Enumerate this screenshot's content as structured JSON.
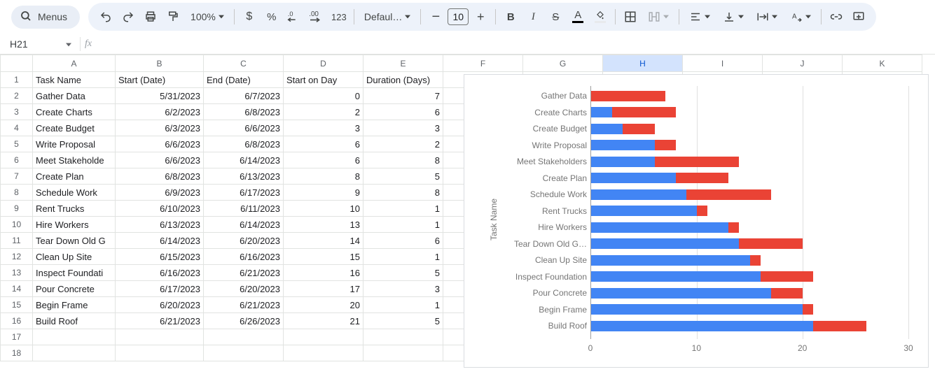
{
  "toolbar": {
    "menus_label": "Menus",
    "zoom": "100%",
    "font_name": "Defaul…",
    "font_size": "10"
  },
  "namebox": {
    "ref": "H21"
  },
  "columns": [
    "A",
    "B",
    "C",
    "D",
    "E",
    "F",
    "G",
    "H",
    "I",
    "J",
    "K"
  ],
  "selected_col": "H",
  "headers": {
    "A": "Task Name",
    "B": "Start (Date)",
    "C": "End (Date)",
    "D": "Start on Day",
    "E": "Duration (Days)"
  },
  "rows": [
    {
      "task": "Gather Data",
      "start": "5/31/2023",
      "end": "6/7/2023",
      "start_day": "0",
      "duration": "7"
    },
    {
      "task": "Create Charts",
      "start": "6/2/2023",
      "end": "6/8/2023",
      "start_day": "2",
      "duration": "6"
    },
    {
      "task": "Create Budget",
      "start": "6/3/2023",
      "end": "6/6/2023",
      "start_day": "3",
      "duration": "3"
    },
    {
      "task": "Write Proposal",
      "start": "6/6/2023",
      "end": "6/8/2023",
      "start_day": "6",
      "duration": "2"
    },
    {
      "task": "Meet Stakeholde",
      "start": "6/6/2023",
      "end": "6/14/2023",
      "start_day": "6",
      "duration": "8"
    },
    {
      "task": "Create Plan",
      "start": "6/8/2023",
      "end": "6/13/2023",
      "start_day": "8",
      "duration": "5"
    },
    {
      "task": "Schedule Work",
      "start": "6/9/2023",
      "end": "6/17/2023",
      "start_day": "9",
      "duration": "8"
    },
    {
      "task": "Rent Trucks",
      "start": "6/10/2023",
      "end": "6/11/2023",
      "start_day": "10",
      "duration": "1"
    },
    {
      "task": "Hire Workers",
      "start": "6/13/2023",
      "end": "6/14/2023",
      "start_day": "13",
      "duration": "1"
    },
    {
      "task": "Tear Down Old G",
      "start": "6/14/2023",
      "end": "6/20/2023",
      "start_day": "14",
      "duration": "6"
    },
    {
      "task": "Clean Up Site",
      "start": "6/15/2023",
      "end": "6/16/2023",
      "start_day": "15",
      "duration": "1"
    },
    {
      "task": "Inspect Foundati",
      "start": "6/16/2023",
      "end": "6/21/2023",
      "start_day": "16",
      "duration": "5"
    },
    {
      "task": "Pour Concrete",
      "start": "6/17/2023",
      "end": "6/20/2023",
      "start_day": "17",
      "duration": "3"
    },
    {
      "task": "Begin Frame",
      "start": "6/20/2023",
      "end": "6/21/2023",
      "start_day": "20",
      "duration": "1"
    },
    {
      "task": "Build Roof",
      "start": "6/21/2023",
      "end": "6/26/2023",
      "start_day": "21",
      "duration": "5"
    }
  ],
  "chart_data": {
    "type": "bar",
    "orientation": "horizontal",
    "stacked": true,
    "ylabel": "Task Name",
    "xlim": [
      0,
      30
    ],
    "xticks": [
      0,
      10,
      20,
      30
    ],
    "categories": [
      "Gather Data",
      "Create Charts",
      "Create Budget",
      "Write Proposal",
      "Meet Stakeholders",
      "Create Plan",
      "Schedule Work",
      "Rent Trucks",
      "Hire Workers",
      "Tear Down Old G…",
      "Clean Up Site",
      "Inspect Foundation",
      "Pour Concrete",
      "Begin Frame",
      "Build Roof"
    ],
    "series": [
      {
        "name": "Start on Day",
        "color": "#4285f4",
        "values": [
          0,
          2,
          3,
          6,
          6,
          8,
          9,
          10,
          13,
          14,
          15,
          16,
          17,
          20,
          21
        ]
      },
      {
        "name": "Duration (Days)",
        "color": "#ea4335",
        "values": [
          7,
          6,
          3,
          2,
          8,
          5,
          8,
          1,
          1,
          6,
          1,
          5,
          3,
          1,
          5
        ]
      }
    ]
  }
}
